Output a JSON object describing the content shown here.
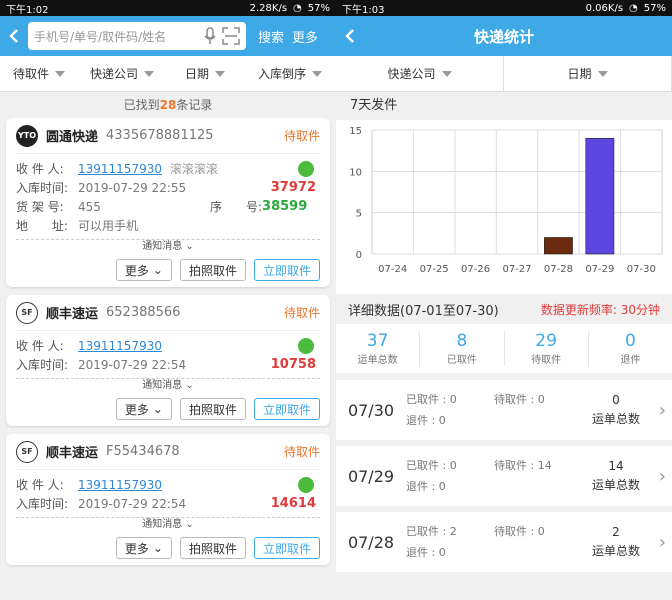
{
  "left": {
    "status": {
      "time": "下午1:02",
      "speed": "2.28K/s",
      "battery": "57%"
    },
    "search": {
      "placeholder": "手机号/单号/取件码/姓名",
      "search_label": "搜索",
      "more_label": "更多"
    },
    "filters": [
      "待取件",
      "快递公司",
      "日期",
      "入库倒序"
    ],
    "found": {
      "prefix": "已找到",
      "count": "28",
      "suffix": "条记录"
    },
    "cards": [
      {
        "logo": "YTO",
        "company": "圆通快递",
        "tracking": "4335678881125",
        "status": "待取件",
        "recipient_label": "收 件 人:",
        "phone": "13911157930",
        "nickname": "滚滚滚滚",
        "time_label": "入库时间:",
        "time": "2019-07-29 22:55",
        "code": "37972",
        "shelf_label": "货 架 号:",
        "shelf": "455",
        "seq_label": "序　　号:",
        "seq": "38599",
        "addr_label": "地　　址:",
        "addr": "可以用手机",
        "notice": "通知消息",
        "more": "更多",
        "photo": "拍照取件",
        "pickup": "立即取件"
      },
      {
        "logo": "SF",
        "company": "顺丰速运",
        "tracking": "652388566",
        "status": "待取件",
        "recipient_label": "收 件 人:",
        "phone": "13911157930",
        "time_label": "入库时间:",
        "time": "2019-07-29 22:54",
        "code": "10758",
        "notice": "通知消息",
        "more": "更多",
        "photo": "拍照取件",
        "pickup": "立即取件"
      },
      {
        "logo": "SF",
        "company": "顺丰速运",
        "tracking": "F55434678",
        "status": "待取件",
        "recipient_label": "收 件 人:",
        "phone": "13911157930",
        "time_label": "入库时间:",
        "time": "2019-07-29 22:54",
        "code": "14614",
        "notice": "通知消息",
        "more": "更多",
        "photo": "拍照取件",
        "pickup": "立即取件"
      }
    ]
  },
  "right": {
    "status": {
      "time": "下午1:03",
      "speed": "0.06K/s",
      "battery": "57%"
    },
    "title": "快递统计",
    "filters": [
      "快递公司",
      "日期"
    ],
    "chart_section": "7天发件",
    "chart_data": {
      "type": "bar",
      "categories": [
        "07-24",
        "07-25",
        "07-26",
        "07-27",
        "07-28",
        "07-29",
        "07-30"
      ],
      "values": [
        0,
        0,
        0,
        0,
        2,
        14,
        0
      ],
      "colors": [
        "#6b2a0e",
        "#6b2a0e",
        "#6b2a0e",
        "#6b2a0e",
        "#6b2a0e",
        "#5b46e0",
        "#5b46e0"
      ],
      "yticks": [
        0,
        5,
        10,
        15
      ],
      "ylim": [
        0,
        15
      ],
      "grid": true
    },
    "detail": {
      "title": "详细数据(07-01至07-30)",
      "rate": "数据更新频率: 30分钟"
    },
    "stats": [
      {
        "value": "37",
        "label": "运单总数"
      },
      {
        "value": "8",
        "label": "已取件"
      },
      {
        "value": "29",
        "label": "待取件"
      },
      {
        "value": "0",
        "label": "退件"
      }
    ],
    "days": [
      {
        "date": "07/30",
        "picked": "已取件 : 0",
        "pending": "待取件 : 0",
        "returned": "退件 : 0",
        "total": "0",
        "total_label": "运单总数"
      },
      {
        "date": "07/29",
        "picked": "已取件 : 0",
        "pending": "待取件 : 14",
        "returned": "退件 : 0",
        "total": "14",
        "total_label": "运单总数"
      },
      {
        "date": "07/28",
        "picked": "已取件 : 2",
        "pending": "待取件 : 0",
        "returned": "退件 : 0",
        "total": "2",
        "total_label": "运单总数"
      }
    ]
  }
}
